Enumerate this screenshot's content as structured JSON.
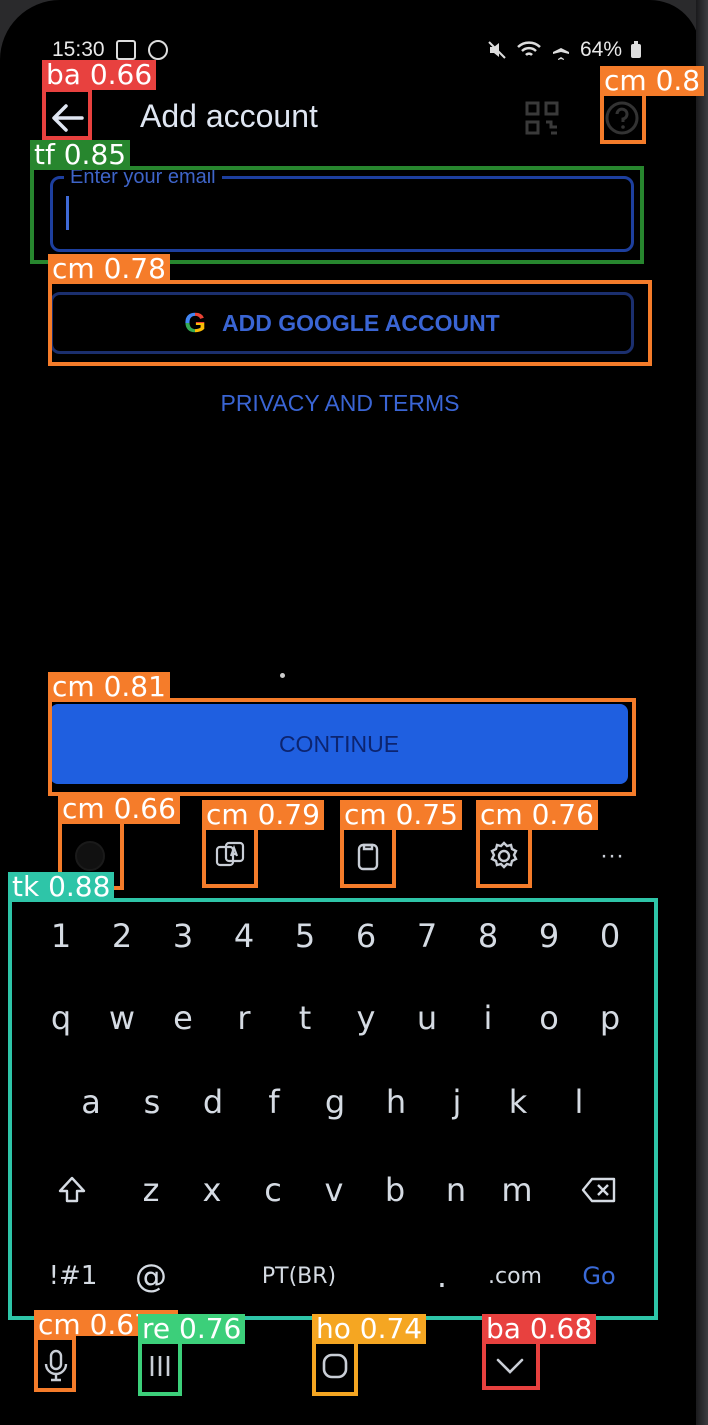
{
  "status_bar": {
    "time": "15:30",
    "battery": "64%"
  },
  "header": {
    "title": "Add account"
  },
  "email_field": {
    "label": "Enter your email",
    "value": ""
  },
  "google_button": {
    "icon_letter": "G",
    "label": "ADD GOOGLE ACCOUNT"
  },
  "privacy_link": "PRIVACY AND TERMS",
  "continue_button": "CONTINUE",
  "keyboard_toolbar": {
    "more": "···"
  },
  "keyboard": {
    "numbers": [
      "1",
      "2",
      "3",
      "4",
      "5",
      "6",
      "7",
      "8",
      "9",
      "0"
    ],
    "row1": [
      "q",
      "w",
      "e",
      "r",
      "t",
      "y",
      "u",
      "i",
      "o",
      "p"
    ],
    "row2": [
      "a",
      "s",
      "d",
      "f",
      "g",
      "h",
      "j",
      "k",
      "l"
    ],
    "row3": [
      "z",
      "x",
      "c",
      "v",
      "b",
      "n",
      "m"
    ],
    "symbols": "!#1",
    "at": "@",
    "language": "PT(BR)",
    "period": ".",
    "dotcom": ".com",
    "go": "Go"
  },
  "detections": [
    {
      "label": "ba 0.66"
    },
    {
      "label": "cm 0.8"
    },
    {
      "label": "tf 0.85"
    },
    {
      "label": "cm 0.78"
    },
    {
      "label": "cm 0.81"
    },
    {
      "label": "cm 0.66"
    },
    {
      "label": "cm 0.79"
    },
    {
      "label": "cm 0.75"
    },
    {
      "label": "cm 0.76"
    },
    {
      "label": "tk 0.88"
    },
    {
      "label": "cm 0.67"
    },
    {
      "label": "re 0.76"
    },
    {
      "label": "ho 0.74"
    },
    {
      "label": "ba 0.68"
    }
  ]
}
